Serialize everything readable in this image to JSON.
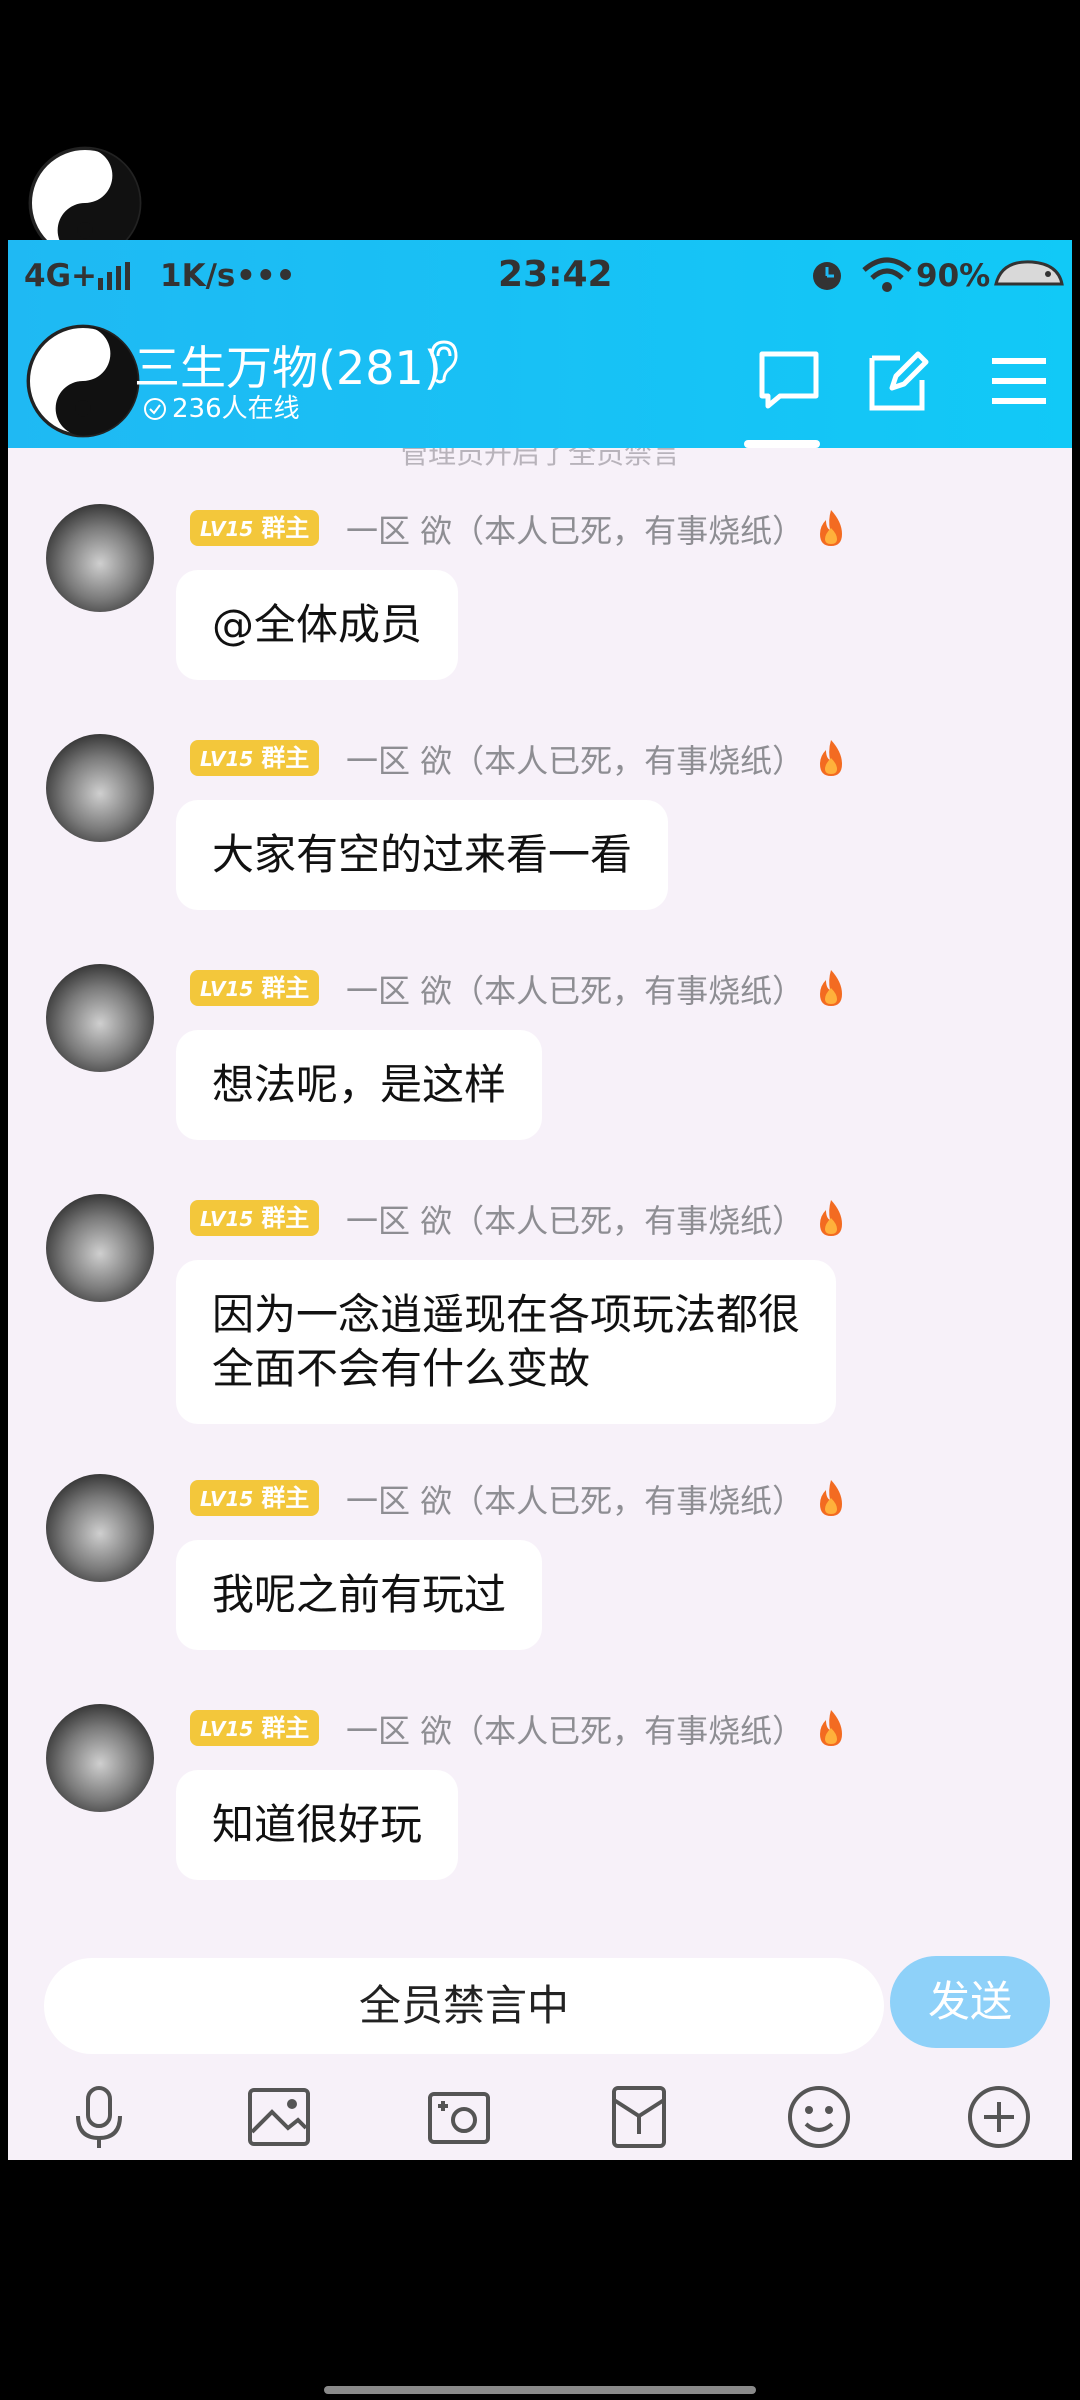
{
  "status_bar": {
    "network": "4G+",
    "speed": "1K/s",
    "dots": "•••",
    "time": "23:42",
    "battery": "90%"
  },
  "header": {
    "group_name": "三生万物(281)",
    "online": "236人在线"
  },
  "partial_notice": "管理员开启了全员禁言",
  "messages": [
    {
      "level": "LV15",
      "role": "群主",
      "sender": "一区 欲（本人已死，有事烧纸）",
      "text_lines": [
        "@全体成员"
      ]
    },
    {
      "level": "LV15",
      "role": "群主",
      "sender": "一区 欲（本人已死，有事烧纸）",
      "text_lines": [
        "大家有空的过来看一看"
      ]
    },
    {
      "level": "LV15",
      "role": "群主",
      "sender": "一区 欲（本人已死，有事烧纸）",
      "text_lines": [
        "想法呢，是这样"
      ]
    },
    {
      "level": "LV15",
      "role": "群主",
      "sender": "一区 欲（本人已死，有事烧纸）",
      "text_lines": [
        "因为一念逍遥现在各项玩法都很",
        "全面不会有什么变故"
      ]
    },
    {
      "level": "LV15",
      "role": "群主",
      "sender": "一区 欲（本人已死，有事烧纸）",
      "text_lines": [
        "我呢之前有玩过"
      ]
    },
    {
      "level": "LV15",
      "role": "群主",
      "sender": "一区 欲（本人已死，有事烧纸）",
      "text_lines": [
        "知道很好玩"
      ]
    }
  ],
  "input": {
    "muted_text": "全员禁言中",
    "send_label": "发送"
  },
  "toolbar_icons": [
    "microphone-icon",
    "image-icon",
    "camera-icon",
    "red-packet-icon",
    "emoji-icon",
    "plus-icon"
  ],
  "colors": {
    "header_bg": "#1fb9f3",
    "badge": "#f3c73b",
    "send_disabled": "#8ed1f9",
    "chat_bg": "#f7f1f9"
  }
}
